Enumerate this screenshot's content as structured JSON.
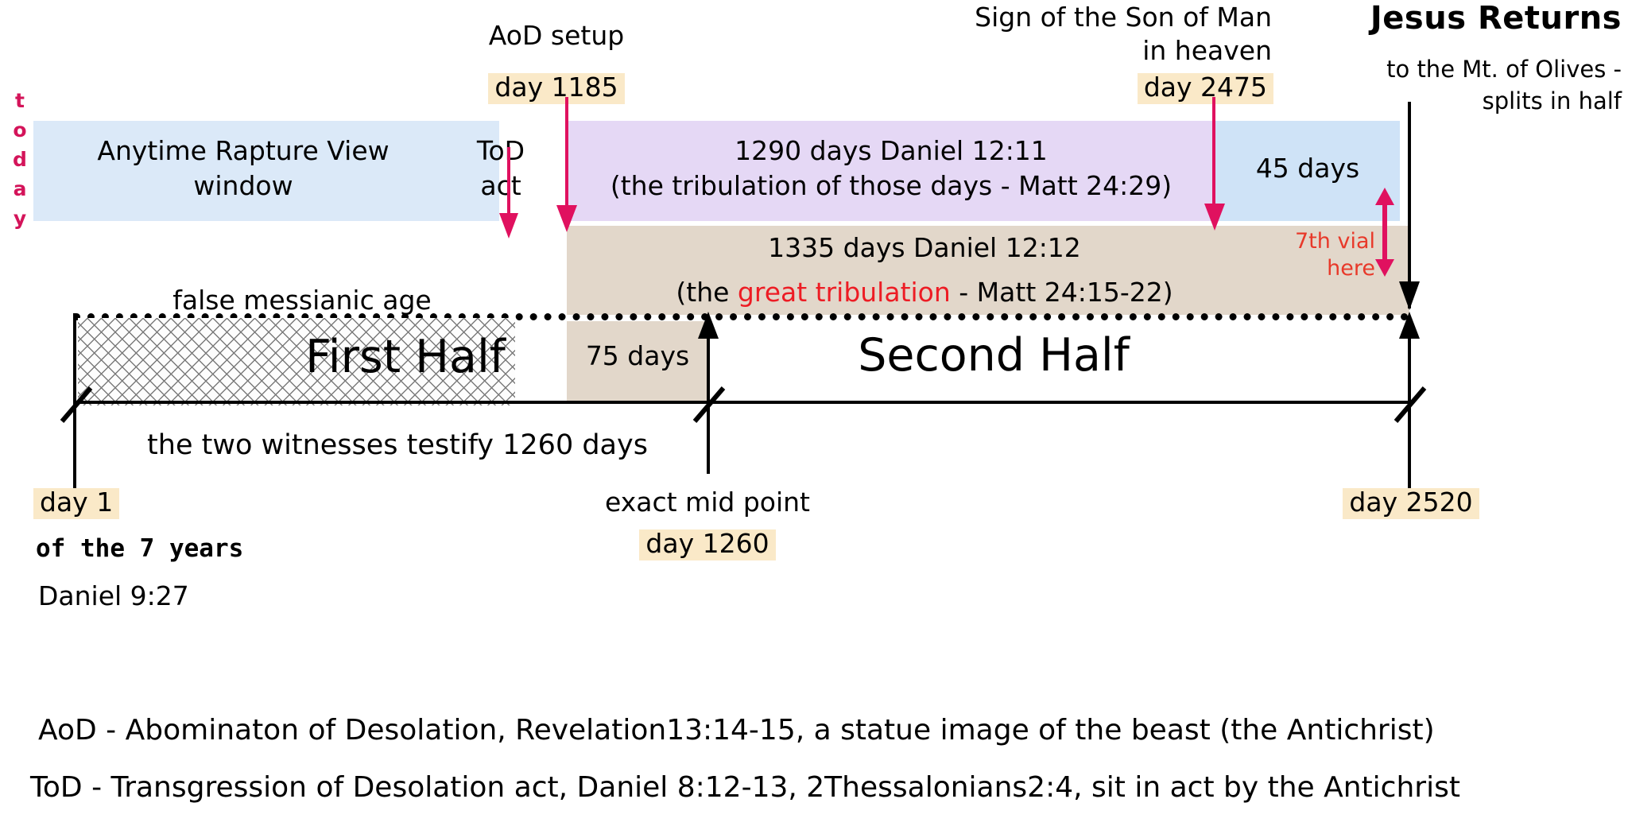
{
  "title": "Seven Year Tribulation Timeline",
  "left_edge": {
    "today_label": "today",
    "today_letters": [
      "t",
      "o",
      "d",
      "a",
      "y"
    ]
  },
  "top_annotations": [
    {
      "id": "aod",
      "lines": [
        "AoD setup"
      ],
      "day_chip": "day 1185"
    },
    {
      "id": "sign",
      "lines": [
        "Sign of the Son of Man",
        "in heaven"
      ],
      "day_chip": "day 2475"
    },
    {
      "id": "return",
      "heading": "Jesus Returns",
      "lines": [
        "to the Mt. of Olives -",
        "splits in half"
      ]
    }
  ],
  "bands": {
    "rapture": {
      "line1": "Anytime Rapture View",
      "line2": "window",
      "tod_line1": "ToD",
      "tod_line2": "act"
    },
    "d1290": {
      "line1": "1290 days   Daniel 12:11",
      "line2": "(the tribulation of those days - Matt 24:29)"
    },
    "d45": {
      "label": "45 days"
    },
    "d1335": {
      "line1": "1335 days   Daniel 12:12",
      "line2_pre": "(the ",
      "line2_red": "great tribulation",
      "line2_post": " - Matt 24:15-22)"
    },
    "vial": {
      "line1": "7th vial",
      "line2": "here"
    }
  },
  "timeline": {
    "false_age": "false messianic age",
    "first_half": "First Half",
    "seventy_five": "75 days",
    "second_half": "Second Half",
    "two_witnesses": "the two witnesses testify 1260 days"
  },
  "markers": {
    "day1": {
      "chip": "day 1",
      "sub1": "of the 7 years",
      "sub2": "Daniel 9:27"
    },
    "midpoint": {
      "label": "exact mid point",
      "chip": "day 1260"
    },
    "day2520": {
      "chip": "day 2520"
    }
  },
  "footnotes": [
    "AoD - Abominaton of Desolation, Revelation13:14-15, a statue image of the beast (the Antichrist)",
    "ToD - Transgression of Desolation act, Daniel 8:12-13, 2Thessalonians2:4, sit in act by the Antichrist"
  ],
  "colors": {
    "pink": "#e0115f",
    "red": "#ed1c24",
    "chip": "#fae9c8",
    "band_blue": "#dbe9f8",
    "band_purple": "#e5d8f5",
    "band_tan": "#e2d7ca",
    "band_lblue": "#cfe3f7"
  },
  "chart_data": {
    "type": "table",
    "title": "Seven Year Tribulation Timeline (Daniel 9:27)",
    "xlabel": "day of the 7 years",
    "xlim": [
      1,
      2520
    ],
    "grid": false,
    "legend": "none",
    "categories": [
      "First Half",
      "75 days",
      "Second Half"
    ],
    "milestones": [
      {
        "label": "day 1",
        "day": 1,
        "note": "of the 7 years - Daniel 9:27"
      },
      {
        "label": "day 1185",
        "day": 1185,
        "note": "AoD setup"
      },
      {
        "label": "day 1260",
        "day": 1260,
        "note": "exact mid point"
      },
      {
        "label": "day 2475",
        "day": 2475,
        "note": "Sign of the Son of Man in heaven"
      },
      {
        "label": "day 2520",
        "day": 2520,
        "note": "Jesus Returns to the Mt. of Olives - splits in half"
      }
    ],
    "spans": [
      {
        "name": "Anytime Rapture View window",
        "start": 1,
        "end": 1150,
        "value": 1149,
        "color": "#dbe9f8"
      },
      {
        "name": "1290 days Daniel 12:11 (the tribulation of those days - Matt 24:29)",
        "start": 1185,
        "end": 2475,
        "value": 1290,
        "color": "#e5d8f5"
      },
      {
        "name": "45 days",
        "start": 2475,
        "end": 2520,
        "value": 45,
        "color": "#cfe3f7"
      },
      {
        "name": "1335 days Daniel 12:12 (the great tribulation - Matt 24:15-22)",
        "start": 1185,
        "end": 2520,
        "value": 1335,
        "color": "#e2d7ca"
      },
      {
        "name": "First Half",
        "start": 1,
        "end": 1260,
        "value": 1260,
        "color": "#ffffff"
      },
      {
        "name": "75 days",
        "start": 1185,
        "end": 1260,
        "value": 75,
        "color": "#e2d7ca"
      },
      {
        "name": "Second Half",
        "start": 1260,
        "end": 2520,
        "value": 1260,
        "color": "#ffffff"
      },
      {
        "name": "the two witnesses testify 1260 days",
        "start": 1,
        "end": 1260,
        "value": 1260,
        "color": "#ffffff"
      }
    ]
  }
}
